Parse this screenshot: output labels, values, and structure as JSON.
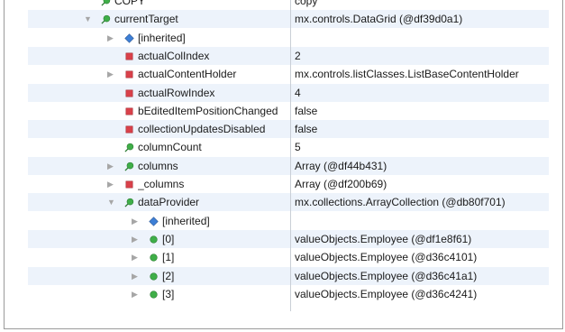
{
  "rows": [
    {
      "name": "COPY",
      "value": "copy",
      "icon": "green-circle-pin-icon",
      "expander": "none",
      "level": 1
    },
    {
      "name": "currentTarget",
      "value": "mx.controls.DataGrid (@df39d0a1)",
      "icon": "green-circle-pin-icon",
      "expander": "expanded",
      "level": 1
    },
    {
      "name": "[inherited]",
      "value": "",
      "icon": "blue-diamond-icon",
      "expander": "collapsed",
      "level": 2
    },
    {
      "name": "actualColIndex",
      "value": "2",
      "icon": "red-square-icon",
      "expander": "none",
      "level": 2
    },
    {
      "name": "actualContentHolder",
      "value": "mx.controls.listClasses.ListBaseContentHolder",
      "icon": "red-square-icon",
      "expander": "collapsed",
      "level": 2
    },
    {
      "name": "actualRowIndex",
      "value": "4",
      "icon": "red-square-icon",
      "expander": "none",
      "level": 2
    },
    {
      "name": "bEditedItemPositionChanged",
      "value": "false",
      "icon": "red-square-icon",
      "expander": "none",
      "level": 2
    },
    {
      "name": "collectionUpdatesDisabled",
      "value": "false",
      "icon": "red-square-icon",
      "expander": "none",
      "level": 2
    },
    {
      "name": "columnCount",
      "value": "5",
      "icon": "green-circle-pin-icon",
      "expander": "none",
      "level": 2
    },
    {
      "name": "columns",
      "value": "Array (@df44b431)",
      "icon": "green-circle-pin-icon",
      "expander": "collapsed",
      "level": 2
    },
    {
      "name": "_columns",
      "value": "Array (@df200b69)",
      "icon": "red-square-icon",
      "expander": "collapsed",
      "level": 2
    },
    {
      "name": "dataProvider",
      "value": "mx.collections.ArrayCollection (@db80f701)",
      "icon": "green-circle-pin-icon",
      "expander": "expanded",
      "level": 2
    },
    {
      "name": "[inherited]",
      "value": "",
      "icon": "blue-diamond-icon",
      "expander": "collapsed",
      "level": 3
    },
    {
      "name": "[0]",
      "value": "valueObjects.Employee (@df1e8f61)",
      "icon": "green-circle-icon",
      "expander": "collapsed",
      "level": 3
    },
    {
      "name": "[1]",
      "value": "valueObjects.Employee (@d36c4101)",
      "icon": "green-circle-icon",
      "expander": "collapsed",
      "level": 3
    },
    {
      "name": "[2]",
      "value": "valueObjects.Employee (@d36c41a1)",
      "icon": "green-circle-icon",
      "expander": "collapsed",
      "level": 3
    },
    {
      "name": "[3]",
      "value": "valueObjects.Employee (@d36c4241)",
      "icon": "green-circle-icon",
      "expander": "collapsed",
      "level": 3
    }
  ],
  "colors": {
    "row_alt": "#edf3fb",
    "divider": "#c9cfd6",
    "green": "#3fae48",
    "red": "#d9414a",
    "blue": "#3d7fd6"
  }
}
